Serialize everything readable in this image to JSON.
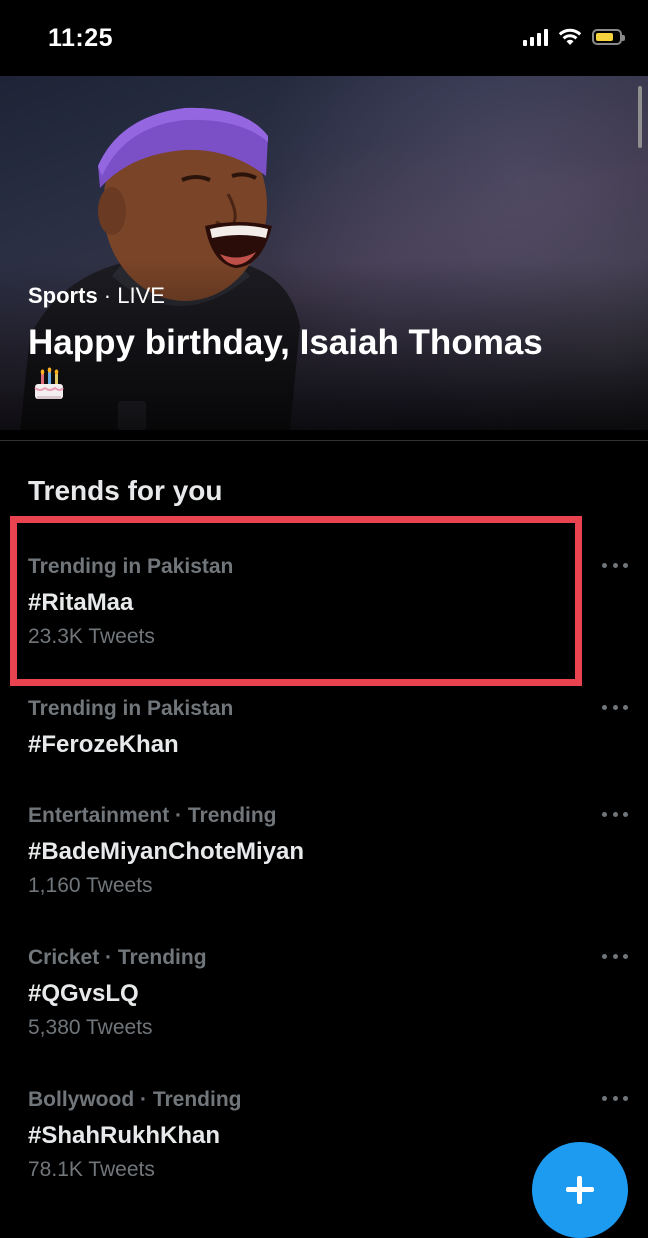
{
  "status_bar": {
    "time": "11:25"
  },
  "hero": {
    "category": "Sports",
    "live_label": " · LIVE",
    "title": "Happy birthday, Isaiah Thomas",
    "cake_icon": "birthday-cake-icon"
  },
  "trends_section": {
    "title": "Trends for you"
  },
  "trends": [
    {
      "context": "Trending in Pakistan",
      "name": "#RitaMaa",
      "count": "23.3K Tweets"
    },
    {
      "context": "Trending in Pakistan",
      "name": "#FerozeKhan",
      "count": ""
    },
    {
      "context": "Entertainment · Trending",
      "name": "#BadeMiyanChoteMiyan",
      "count": "1,160 Tweets"
    },
    {
      "context": "Cricket · Trending",
      "name": "#QGvsLQ",
      "count": "5,380 Tweets"
    },
    {
      "context": "Bollywood · Trending",
      "name": "#ShahRukhKhan",
      "count": "78.1K Tweets"
    }
  ],
  "colors": {
    "background": "#000000",
    "primary_text": "#e7e9ea",
    "secondary_text": "#71767b",
    "highlight": "#e8434f",
    "accent": "#1d9bf0",
    "battery": "#f5d33f"
  },
  "fab": {
    "icon": "plus-icon"
  }
}
